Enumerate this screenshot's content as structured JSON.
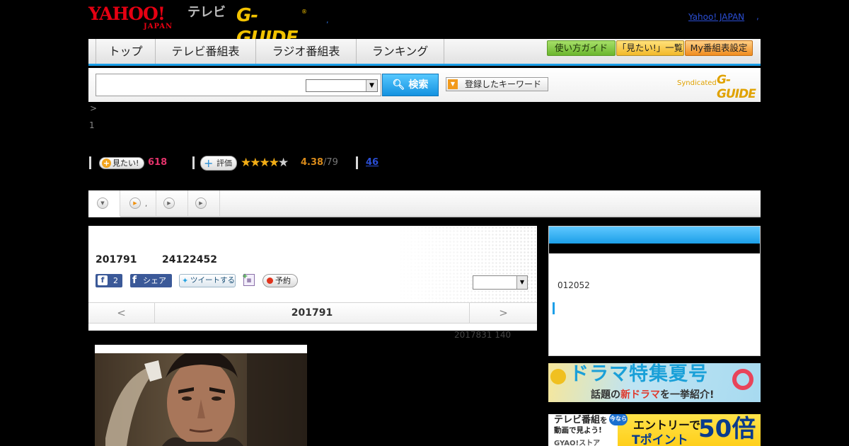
{
  "header": {
    "yahoo_logo": "YAHOO!",
    "yahoo_logo_sub": "JAPAN",
    "tv_label": "テレビ",
    "gguide_logo": "G-GUIDE",
    "gguide_reg": "®",
    "dot": ",",
    "yahoo_japan_link": "Yahoo! JAPAN",
    "yahoo_japan_link_dot": ","
  },
  "global_nav": {
    "tabs": [
      "トップ",
      "テレビ番組表",
      "ラジオ番組表",
      "ランキング"
    ],
    "utility_buttons": [
      "使い方ガイド",
      "「見たい!」一覧",
      "My番組表設定"
    ]
  },
  "search": {
    "input_value": "",
    "select_value": "",
    "button_label": "検索",
    "keyword_button_label": "登録したキーワード",
    "syndicated_label": "Syndicated",
    "syndicated_logo": "G-GUIDE"
  },
  "breadcrumb": {
    "separator": ">",
    "page_number": "1"
  },
  "actions": {
    "mitai_label": "見たい!",
    "mitai_count": "618",
    "hyouka_label": "評価",
    "rating": 4.38,
    "rating_value": "4.38",
    "rating_count": "/79",
    "comment_count": "46"
  },
  "tabs": {
    "second_tab_dot": ","
  },
  "program": {
    "date": "201791",
    "time": "24122452",
    "fb_like_count": "2",
    "fb_share_label": "シェア",
    "tweet_label": "ツイートする",
    "yoyaku_label": "予約",
    "panel_select_value": "",
    "date_nav_prev": "<",
    "date_nav_date": "201791",
    "date_nav_next": ">",
    "updated_note": "2017831  140"
  },
  "sidebar": {
    "code": "012052"
  },
  "banners": {
    "drama_title": "ドラマ特集夏号",
    "drama_sub_prefix": "話題の",
    "drama_sub_highlight": "新ドラマ",
    "drama_sub_suffix": "を一挙紹介!",
    "gyao_line1": "テレビ番組",
    "gyao_line1_suffix": "を",
    "gyao_line2": "動画で見よう!",
    "gyao_brand": "GYAO!ストア",
    "gyao_imanara": "今なら",
    "gyao_entry": "エントリーで",
    "gyao_tpoint": "Tポイント",
    "gyao_times": "50倍"
  },
  "colors": {
    "accent_blue": "#1a9ee8",
    "rating_orange": "#d88a1a",
    "mitai_pink": "#e3336b",
    "link_blue": "#2b4fd6"
  }
}
